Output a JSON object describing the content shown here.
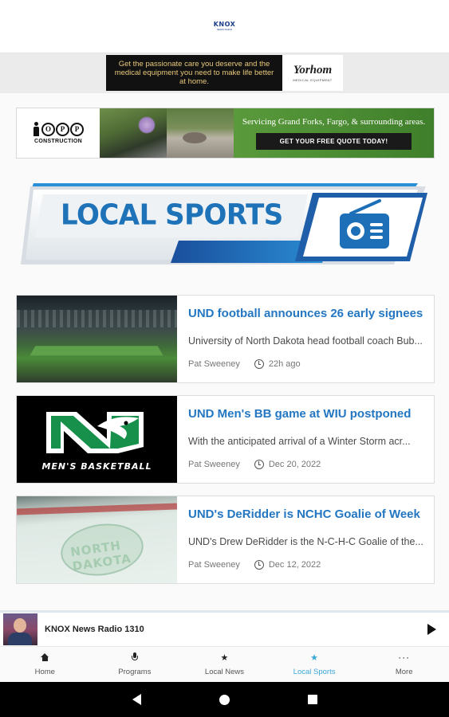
{
  "header": {
    "logo_text": "KNOX",
    "logo_sub": "NEWS RADIO"
  },
  "ad_top": {
    "text": "Get the passionate care you deserve and the medical equipment you need to make life better at home.",
    "brand": "Yorhom",
    "brand_sub": "MEDICAL EQUIPMENT"
  },
  "ad_construction": {
    "logo_letters": [
      "O",
      "P",
      "P"
    ],
    "logo_label": "CONSTRUCTION",
    "tagline": "Servicing Grand Forks, Fargo, & surrounding areas.",
    "cta": "GET YOUR FREE QUOTE TODAY!",
    "colors": {
      "cta_bg": "#4a8a33",
      "button_bg": "#1a1a1a"
    }
  },
  "hero": {
    "title": "LOCAL SPORTS",
    "icon": "radio-icon",
    "accent": "#1d72b8"
  },
  "articles": [
    {
      "title": "UND football announces 26 early signees",
      "excerpt": "University of North Dakota head football coach Bub...",
      "author": "Pat Sweeney",
      "time": "22h ago",
      "image": "stadium-photo"
    },
    {
      "title": "UND Men's BB game at WIU postponed",
      "excerpt": "With the anticipated arrival of a Winter Storm acr...",
      "author": "Pat Sweeney",
      "time": "Dec 20, 2022",
      "image": "mens-basketball-logo",
      "image_label": "MEN'S BASKETBALL"
    },
    {
      "title": "UND's DeRidder is NCHC Goalie of Week",
      "excerpt": "UND's Drew DeRidder is the N-C-H-C Goalie of the...",
      "author": "Pat Sweeney",
      "time": "Dec 12, 2022",
      "image": "ice-rink-photo",
      "image_label": "NORTH DAKOTA"
    }
  ],
  "player": {
    "station": "KNOX News Radio 1310",
    "icon": "play-icon"
  },
  "bottom_nav": [
    {
      "label": "Home",
      "icon": "home-icon"
    },
    {
      "label": "Programs",
      "icon": "mic-icon"
    },
    {
      "label": "Local News",
      "icon": "star-icon"
    },
    {
      "label": "Local Sports",
      "icon": "star-icon",
      "active": true
    },
    {
      "label": "More",
      "icon": "more-icon"
    }
  ],
  "colors": {
    "link": "#2377c2",
    "active_tab": "#3aa7d8"
  }
}
